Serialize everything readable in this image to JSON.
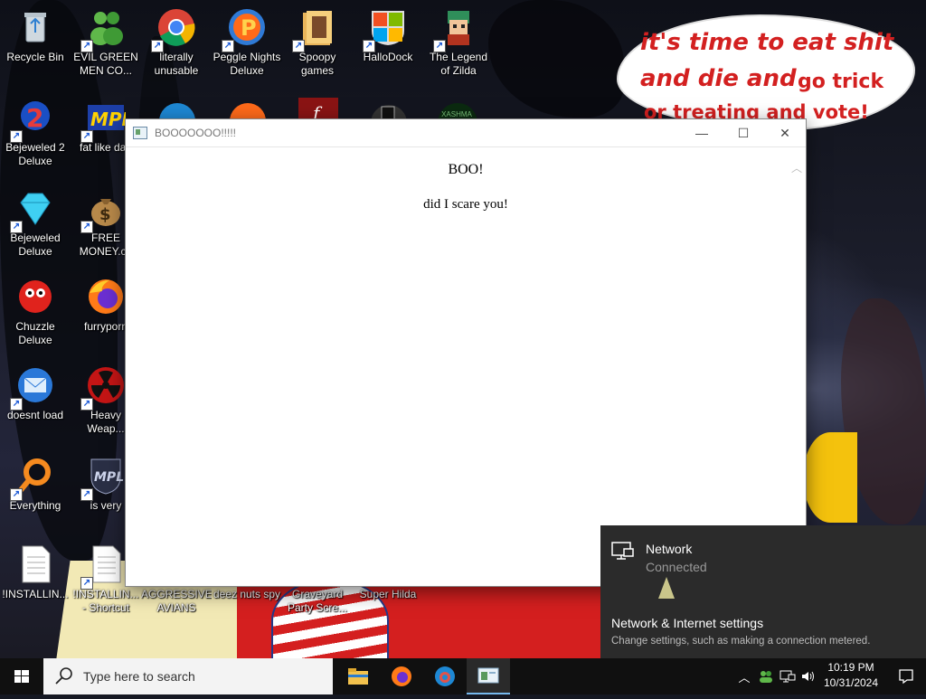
{
  "desktop": {
    "icons": [
      {
        "label": "Recycle Bin",
        "icon": "recycle-bin-icon"
      },
      {
        "label": "EVIL GREEN\nMEN CO...",
        "icon": "green-men-icon"
      },
      {
        "label": "literally\nunusable",
        "icon": "chrome-icon"
      },
      {
        "label": "Peggle Nights\nDeluxe",
        "icon": "peggle-icon"
      },
      {
        "label": "Spoopy\ngames",
        "icon": "folder-icon"
      },
      {
        "label": "HalloDock",
        "icon": "windows-logo-icon"
      },
      {
        "label": "The Legend\nof Zilda",
        "icon": "zilda-icon"
      },
      {
        "label": "Bejeweled 2\nDeluxe",
        "icon": "bejeweled2-icon"
      },
      {
        "label": "fat like darl",
        "icon": "mpl-icon"
      },
      {
        "label": "Bejeweled\nDeluxe",
        "icon": "diamond-icon"
      },
      {
        "label": "FREE\nMONEY.co",
        "icon": "money-bag-icon"
      },
      {
        "label": "Chuzzle\nDeluxe",
        "icon": "chuzzle-icon"
      },
      {
        "label": "furryporn",
        "icon": "firefox-icon"
      },
      {
        "label": "doesnt load",
        "icon": "thunderbird-icon"
      },
      {
        "label": "Heavy\nWeap...",
        "icon": "radiation-icon"
      },
      {
        "label": "Everything",
        "icon": "everything-search-icon"
      },
      {
        "label": "is very",
        "icon": "shield-mpl-icon"
      },
      {
        "label": "!INSTALLIN...",
        "icon": "document-icon"
      },
      {
        "label": "!INSTALLIN...\n- Shortcut",
        "icon": "document-icon"
      },
      {
        "label": "AGGRESSIVE\nAVIANS",
        "icon": ""
      },
      {
        "label": "deez nuts spy",
        "icon": ""
      },
      {
        "label": "Graveyard\nParty Scre...",
        "icon": ""
      },
      {
        "label": "Super Hilda",
        "icon": ""
      }
    ],
    "partial_icon_labels": [
      "XASHMA"
    ],
    "speech_bubble": {
      "line1": "it's time to eat shit",
      "line2a": "and die and",
      "line2b": "go trick",
      "line3": "or treating and vote!"
    }
  },
  "window": {
    "title": "BOOOOOOO!!!!!",
    "minimize": "—",
    "maximize": "☐",
    "close": "✕",
    "heading": "BOO!",
    "text": "did I scare you!"
  },
  "network_flyout": {
    "name": "Network",
    "status": "Connected",
    "settings_link": "Network & Internet settings",
    "settings_desc": "Change settings, such as making a connection metered."
  },
  "taskbar": {
    "search_placeholder": "Type here to search",
    "pinned": [
      "file-explorer-icon",
      "firefox-icon",
      "edge-icon",
      "app-window-icon"
    ],
    "time": "10:19 PM",
    "date": "10/31/2024"
  }
}
